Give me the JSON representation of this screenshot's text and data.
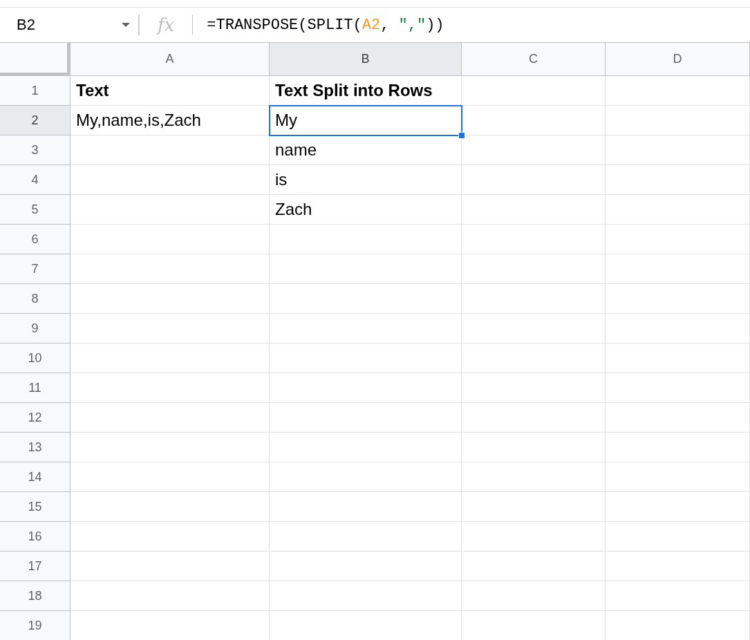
{
  "name_box": {
    "value": "B2"
  },
  "formula_bar": {
    "icon": "fx",
    "parts": [
      {
        "kind": "plain",
        "text": "=TRANSPOSE(SPLIT("
      },
      {
        "kind": "ref",
        "text": "A2"
      },
      {
        "kind": "plain",
        "text": ", "
      },
      {
        "kind": "string",
        "text": "\",\""
      },
      {
        "kind": "plain",
        "text": "))"
      }
    ]
  },
  "columns": [
    {
      "label": "A",
      "selected": false
    },
    {
      "label": "B",
      "selected": true
    },
    {
      "label": "C",
      "selected": false
    },
    {
      "label": "D",
      "selected": false
    }
  ],
  "rows": [
    {
      "number": "1",
      "selected": false,
      "cells": [
        {
          "text": "Text",
          "bold": true
        },
        {
          "text": "Text Split into Rows",
          "bold": true
        }
      ]
    },
    {
      "number": "2",
      "selected": true,
      "cells": [
        {
          "text": "My,name,is,Zach",
          "bold": false
        },
        {
          "text": "My",
          "bold": false,
          "selected": true
        }
      ]
    },
    {
      "number": "3",
      "selected": false,
      "cells": [
        null,
        {
          "text": "name",
          "bold": false
        }
      ]
    },
    {
      "number": "4",
      "selected": false,
      "cells": [
        null,
        {
          "text": "is",
          "bold": false
        }
      ]
    },
    {
      "number": "5",
      "selected": false,
      "cells": [
        null,
        {
          "text": "Zach",
          "bold": false
        }
      ]
    },
    {
      "number": "6",
      "selected": false
    },
    {
      "number": "7",
      "selected": false
    },
    {
      "number": "8",
      "selected": false
    },
    {
      "number": "9",
      "selected": false
    },
    {
      "number": "10",
      "selected": false
    },
    {
      "number": "11",
      "selected": false
    },
    {
      "number": "12",
      "selected": false
    },
    {
      "number": "13",
      "selected": false
    },
    {
      "number": "14",
      "selected": false
    },
    {
      "number": "15",
      "selected": false
    },
    {
      "number": "16",
      "selected": false
    },
    {
      "number": "17",
      "selected": false
    },
    {
      "number": "18",
      "selected": false
    },
    {
      "number": "19",
      "selected": false
    }
  ]
}
